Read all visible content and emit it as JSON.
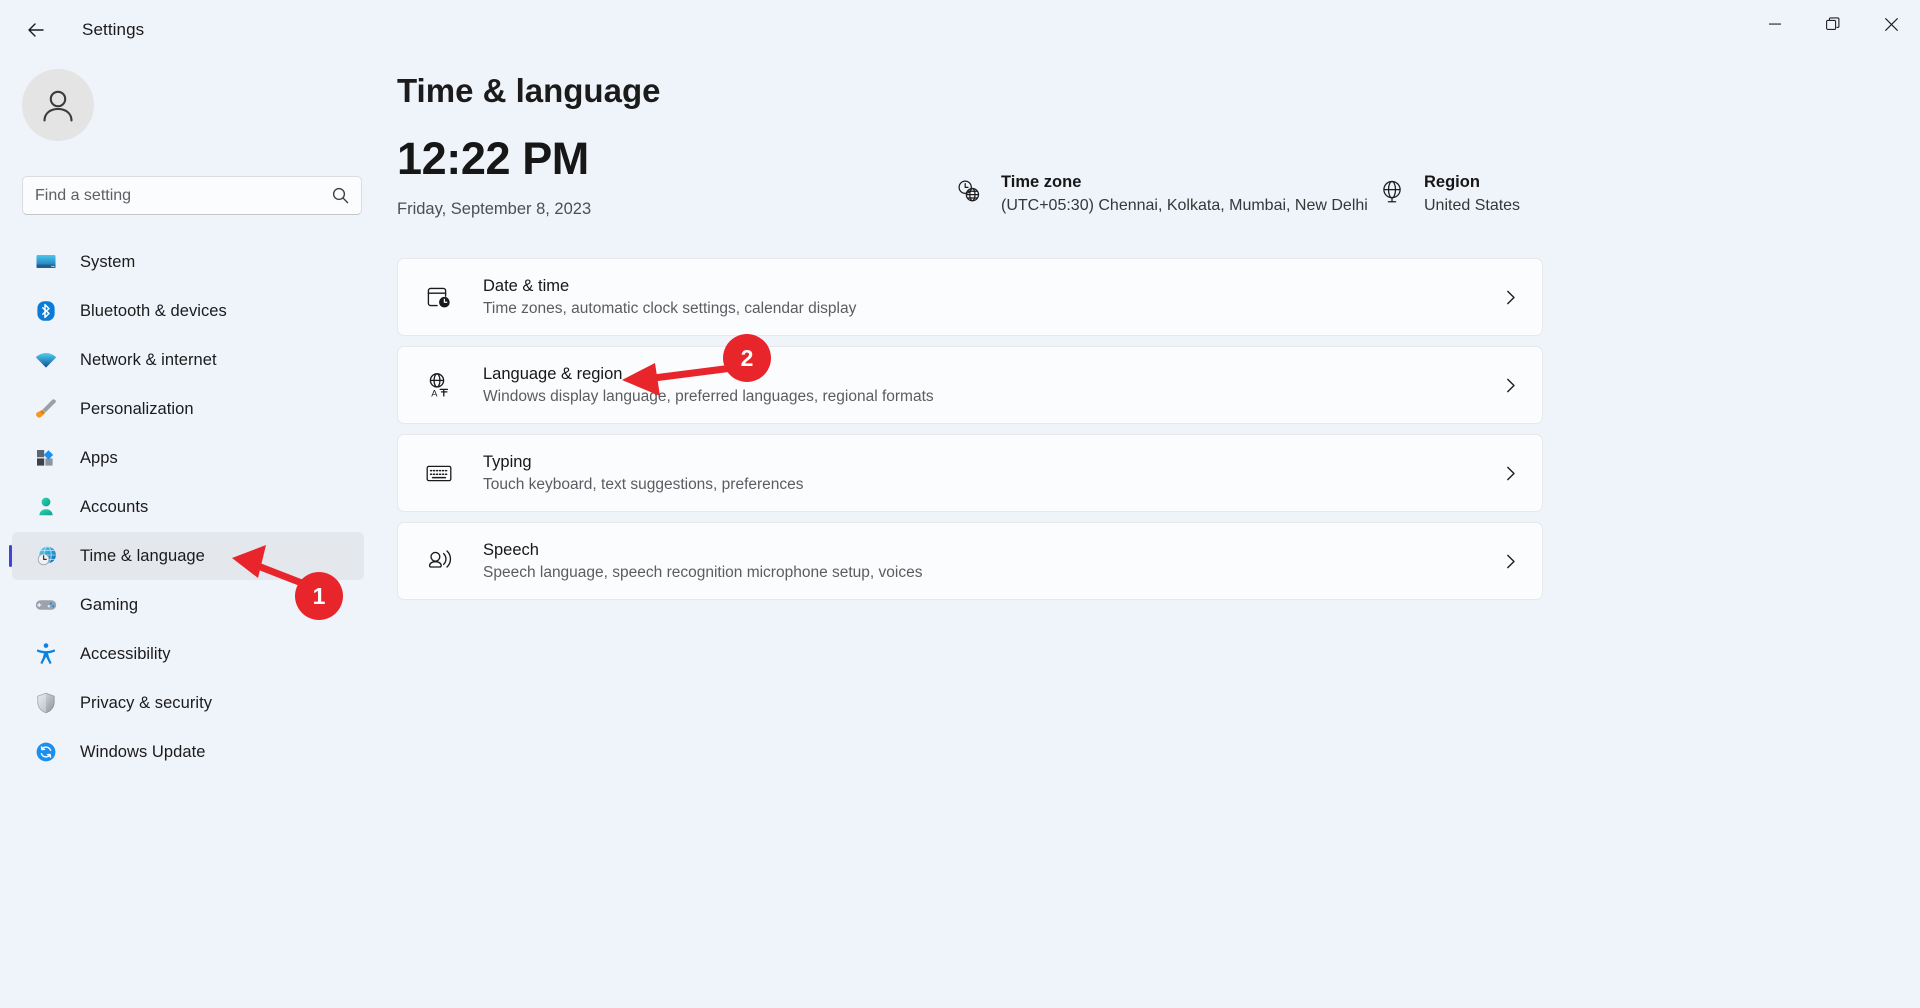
{
  "titlebar": {
    "back_icon": "back-arrow-icon",
    "app_title": "Settings",
    "minimize_label": "—",
    "maximize_label": "❐",
    "close_label": "✕"
  },
  "sidebar": {
    "avatar_icon": "user-avatar-icon",
    "search": {
      "placeholder": "Find a setting",
      "value": "",
      "icon": "search-icon"
    },
    "items": [
      {
        "label": "System",
        "icon": "monitor-icon",
        "active": false
      },
      {
        "label": "Bluetooth & devices",
        "icon": "bluetooth-icon",
        "active": false
      },
      {
        "label": "Network & internet",
        "icon": "wifi-icon",
        "active": false
      },
      {
        "label": "Personalization",
        "icon": "paintbrush-icon",
        "active": false
      },
      {
        "label": "Apps",
        "icon": "apps-icon",
        "active": false
      },
      {
        "label": "Accounts",
        "icon": "person-icon",
        "active": false
      },
      {
        "label": "Time & language",
        "icon": "clock-globe-icon",
        "active": true
      },
      {
        "label": "Gaming",
        "icon": "gamepad-icon",
        "active": false
      },
      {
        "label": "Accessibility",
        "icon": "accessibility-icon",
        "active": false
      },
      {
        "label": "Privacy & security",
        "icon": "shield-icon",
        "active": false
      },
      {
        "label": "Windows Update",
        "icon": "update-refresh-icon",
        "active": false
      }
    ]
  },
  "main": {
    "page_title": "Time & language",
    "clock": {
      "time": "12:22 PM",
      "date": "Friday, September 8, 2023"
    },
    "timezone": {
      "icon": "clock-globe-icon",
      "title": "Time zone",
      "value": "(UTC+05:30) Chennai, Kolkata, Mumbai, New Delhi"
    },
    "region": {
      "icon": "globe-icon",
      "title": "Region",
      "value": "United States"
    },
    "cards": [
      {
        "title": "Date & time",
        "subtitle": "Time zones, automatic clock settings, calendar display",
        "icon": "calendar-clock-icon",
        "chevron": "chevron-right-icon"
      },
      {
        "title": "Language & region",
        "subtitle": "Windows display language, preferred languages, regional formats",
        "icon": "language-globe-icon",
        "chevron": "chevron-right-icon"
      },
      {
        "title": "Typing",
        "subtitle": "Touch keyboard, text suggestions, preferences",
        "icon": "keyboard-icon",
        "chevron": "chevron-right-icon"
      },
      {
        "title": "Speech",
        "subtitle": "Speech language, speech recognition microphone setup, voices",
        "icon": "speech-icon",
        "chevron": "chevron-right-icon"
      }
    ]
  },
  "annotations": {
    "color": "#e8252a",
    "markers": [
      {
        "label": "1",
        "points_at": "sidebar-item-time-language"
      },
      {
        "label": "2",
        "points_at": "card-language-region"
      }
    ]
  }
}
